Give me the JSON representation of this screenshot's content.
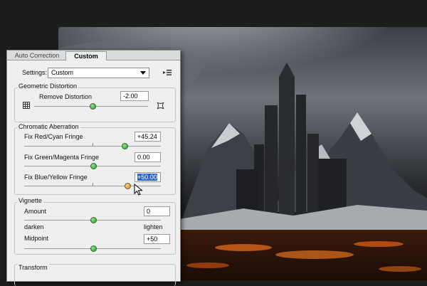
{
  "tabs": [
    {
      "label": "Auto Correction"
    },
    {
      "label": "Custom"
    }
  ],
  "settings": {
    "label": "Settings:",
    "value": "Custom"
  },
  "geometric": {
    "title": "Geometric Distortion",
    "remove_label": "Remove Distortion",
    "remove_value": "-2.00"
  },
  "chromatic": {
    "title": "Chromatic Aberration",
    "red_cyan_label": "Fix Red/Cyan Fringe",
    "red_cyan_value": "+45.24",
    "green_magenta_label": "Fix Green/Magenta Fringe",
    "green_magenta_value": "0.00",
    "blue_yellow_label": "Fix Blue/Yellow Fringe",
    "blue_yellow_value": "+50.00"
  },
  "vignette": {
    "title": "Vignette",
    "amount_label": "Amount",
    "amount_value": "0",
    "darken_label": "darken",
    "lighten_label": "lighten",
    "midpoint_label": "Midpoint",
    "midpoint_value": "+50"
  },
  "transform": {
    "title": "Transform"
  },
  "icons": {
    "settings_menu": "panel-menu-icon",
    "grid": "grid-icon",
    "distortion_tool": "distortion-icon",
    "cursor": "mouse-pointer-icon"
  }
}
